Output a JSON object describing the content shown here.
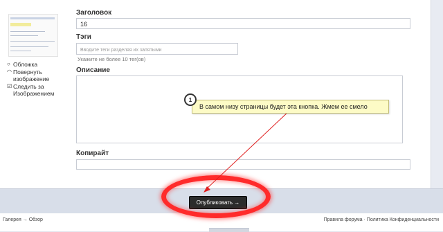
{
  "sidebar": {
    "options": [
      {
        "mark": "○",
        "label": "Обложка"
      },
      {
        "mark": "◠",
        "label": "Повернуть изображение"
      },
      {
        "mark": "☑",
        "label": "Следить за Изображением"
      }
    ]
  },
  "form": {
    "title_label": "Заголовок",
    "title_value": "16",
    "tags_label": "Тэги",
    "tags_placeholder": "Вводите теги разделяя их запятыми",
    "tags_hint": "Укажите не более 10 тег(ов)",
    "description_label": "Описание",
    "copyright_label": "Копирайт"
  },
  "annotation": {
    "number": "1",
    "text": "В самом низу страницы будет эта кнопка. Жмем ее смело",
    "arrow_color": "#e02020",
    "highlight_color": "#ff2b2b"
  },
  "toolbar": {
    "publish_label": "Опубликовать →"
  },
  "footer": {
    "breadcrumb": "Галерея → Обзор",
    "links": "Правила форума · Политика Конфиденциальности"
  }
}
